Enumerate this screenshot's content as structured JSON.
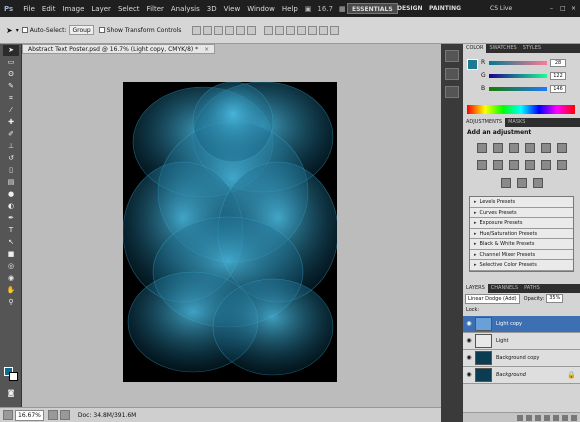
{
  "app": {
    "logo": "Ps",
    "menu": [
      "File",
      "Edit",
      "Image",
      "Layer",
      "Select",
      "Filter",
      "Analysis",
      "3D",
      "View",
      "Window",
      "Help"
    ],
    "zoom_field": "16.7",
    "workspaces": [
      "ESSENTIALS",
      "DESIGN",
      "PAINTING"
    ],
    "cslive": "CS Live"
  },
  "options": {
    "auto_select_label": "Auto-Select:",
    "auto_select_value": "Group",
    "show_transform_label": "Show Transform Controls"
  },
  "document": {
    "tab_title": "Abstract Text Poster.psd @ 16.7% (Light copy, CMYK/8) *",
    "close": "×"
  },
  "status": {
    "zoom": "16.67%",
    "doc_info": "Doc: 34.8M/391.6M"
  },
  "color_panel": {
    "tabs": [
      "COLOR",
      "SWATCHES",
      "STYLES"
    ],
    "r": "28",
    "g": "122",
    "b": "146",
    "r_label": "R",
    "g_label": "G",
    "b_label": "B",
    "fg_color": "#1c7a92"
  },
  "adjustments": {
    "tabs": [
      "ADJUSTMENTS",
      "MASKS"
    ],
    "title": "Add an adjustment",
    "presets": [
      "Levels Presets",
      "Curves Presets",
      "Exposure Presets",
      "Hue/Saturation Presets",
      "Black & White Presets",
      "Channel Mixer Presets",
      "Selective Color Presets"
    ]
  },
  "layers_panel": {
    "tabs": [
      "LAYERS",
      "CHANNELS",
      "PATHS"
    ],
    "blend_mode": "Linear Dodge (Add)",
    "opacity_label": "Opacity:",
    "opacity_value": "35%",
    "lock_label": "Lock:",
    "layers": [
      {
        "name": "Light copy",
        "selected": true
      },
      {
        "name": "Light",
        "selected": false
      },
      {
        "name": "Background copy",
        "selected": false
      },
      {
        "name": "Background",
        "selected": false
      }
    ]
  }
}
